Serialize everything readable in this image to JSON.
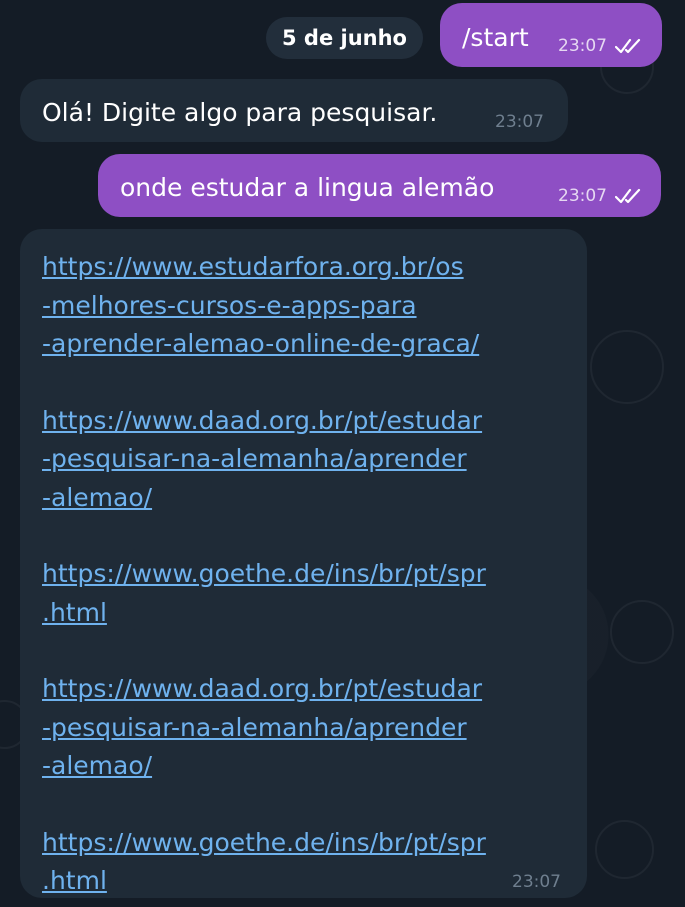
{
  "chat": {
    "date_separator": "5 de junho",
    "messages": [
      {
        "direction": "outgoing",
        "text": "/start",
        "time": "23:07",
        "status": "read"
      },
      {
        "direction": "incoming",
        "text": "Olá! Digite algo para pesquisar.",
        "time": "23:07"
      },
      {
        "direction": "outgoing",
        "text": "onde estudar a lingua alemão",
        "time": "23:07",
        "status": "read"
      },
      {
        "direction": "incoming",
        "time": "23:07",
        "links": [
          [
            "https://www.estudarfora.org.br/os",
            "-melhores-cursos-e-apps-para",
            "-aprender-alemao-online-de-graca/"
          ],
          [
            "https://www.daad.org.br/pt/estudar",
            "-pesquisar-na-alemanha/aprender",
            "-alemao/"
          ],
          [
            "https://www.goethe.de/ins/br/pt/spr",
            ".html"
          ],
          [
            "https://www.daad.org.br/pt/estudar",
            "-pesquisar-na-alemanha/aprender",
            "-alemao/"
          ],
          [
            "https://www.goethe.de/ins/br/pt/spr",
            ".html"
          ]
        ]
      }
    ]
  },
  "colors": {
    "background": "#141c26",
    "outgoing_bubble": "#8e4fc4",
    "incoming_bubble": "#1f2b37",
    "link": "#6fb2ee"
  },
  "icons": {
    "read_receipt": "double-check-icon"
  }
}
